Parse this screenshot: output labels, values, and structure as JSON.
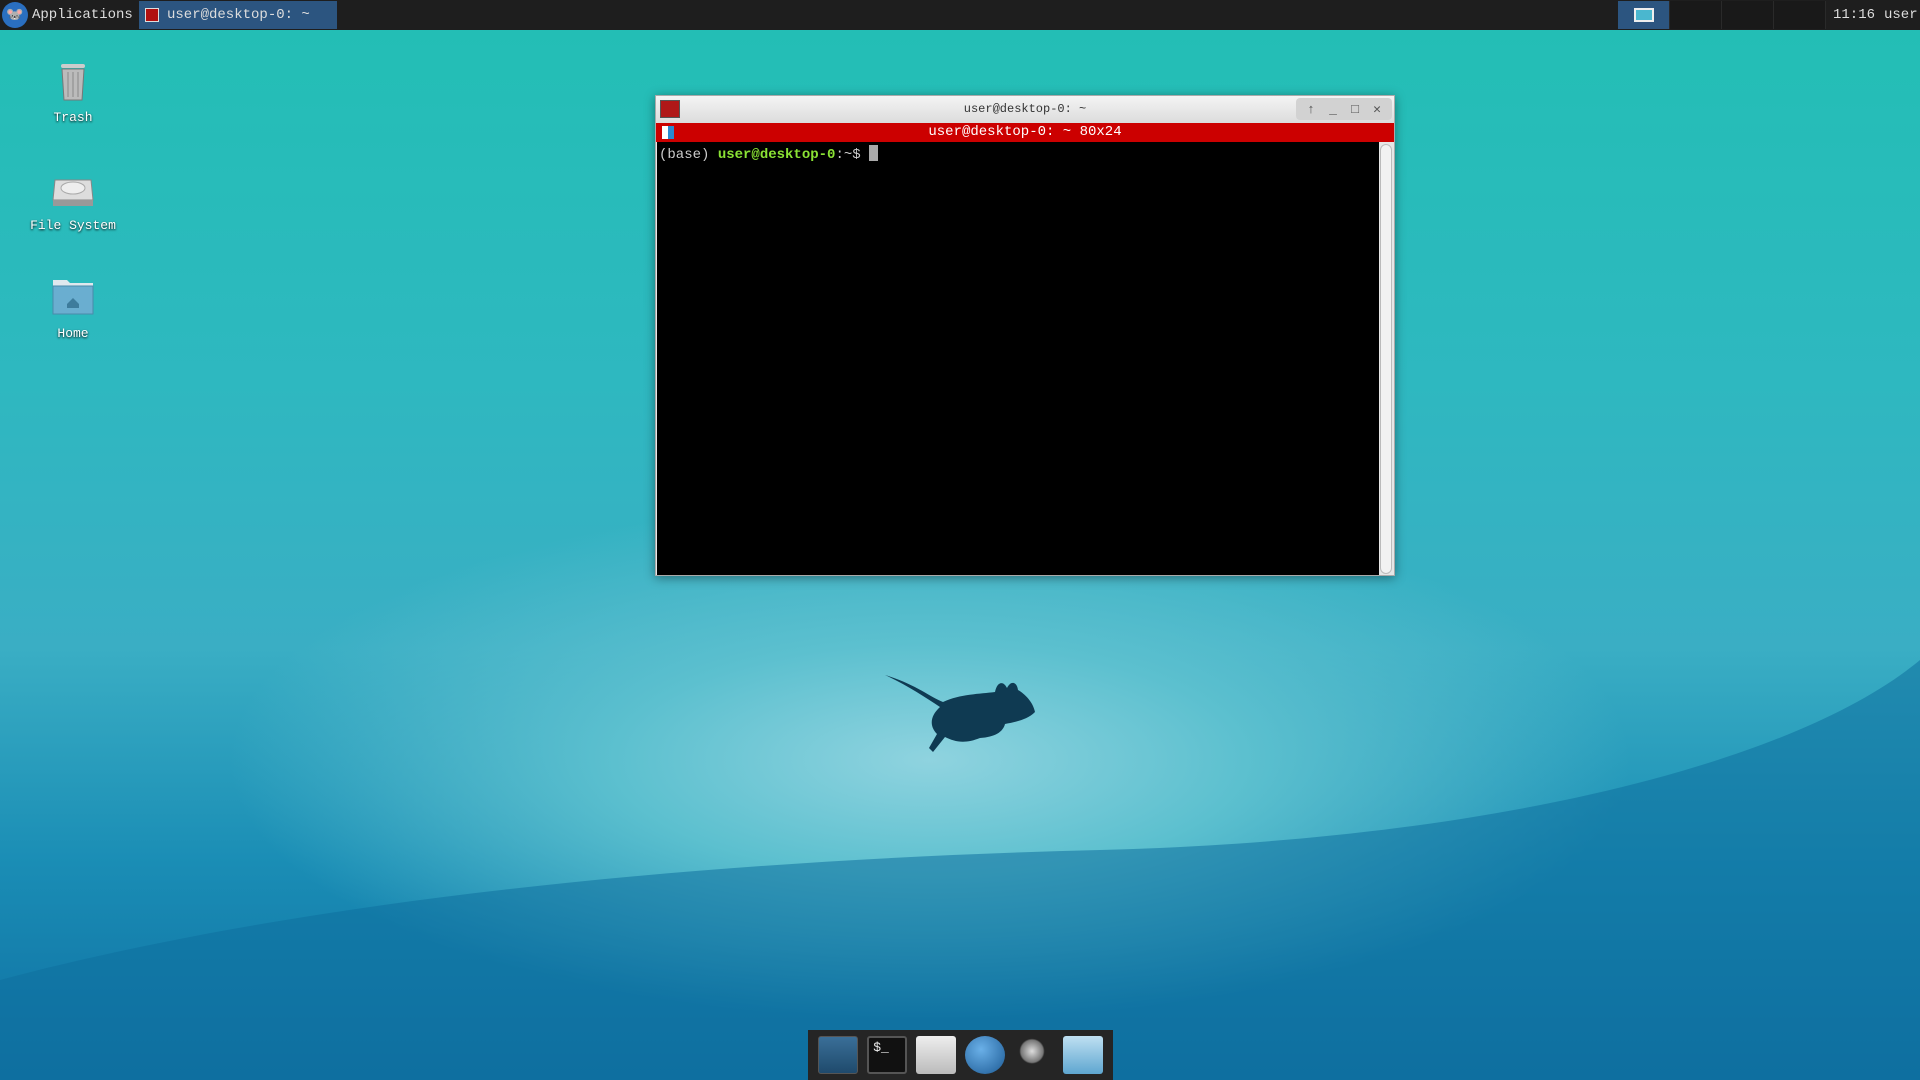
{
  "topbar": {
    "applications_label": "Applications",
    "task_label": "user@desktop-0: ~",
    "clock": "11:16",
    "user": "user",
    "workspaces": [
      {
        "active": true
      },
      {
        "active": false
      },
      {
        "active": false
      },
      {
        "active": false
      }
    ]
  },
  "desktop": {
    "icons": [
      {
        "label": "Trash",
        "icon": "trash-icon"
      },
      {
        "label": "File System",
        "icon": "drive-icon"
      },
      {
        "label": "Home",
        "icon": "home-folder-icon"
      }
    ]
  },
  "terminal": {
    "window_title": "user@desktop-0: ~",
    "tab_title": "user@desktop-0: ~ 80x24",
    "prompt_env": "(base) ",
    "prompt_user": "user@desktop-0",
    "prompt_path": ":~$ "
  },
  "dock": {
    "items": [
      {
        "icon": "show-desktop-icon"
      },
      {
        "icon": "terminal-icon"
      },
      {
        "icon": "home-folder-icon"
      },
      {
        "icon": "web-browser-icon"
      },
      {
        "icon": "search-icon"
      },
      {
        "icon": "folder-icon"
      }
    ]
  },
  "colors": {
    "title_red": "#cc0000",
    "prompt_green": "#8ae234",
    "panel": "#1e1e1e"
  }
}
